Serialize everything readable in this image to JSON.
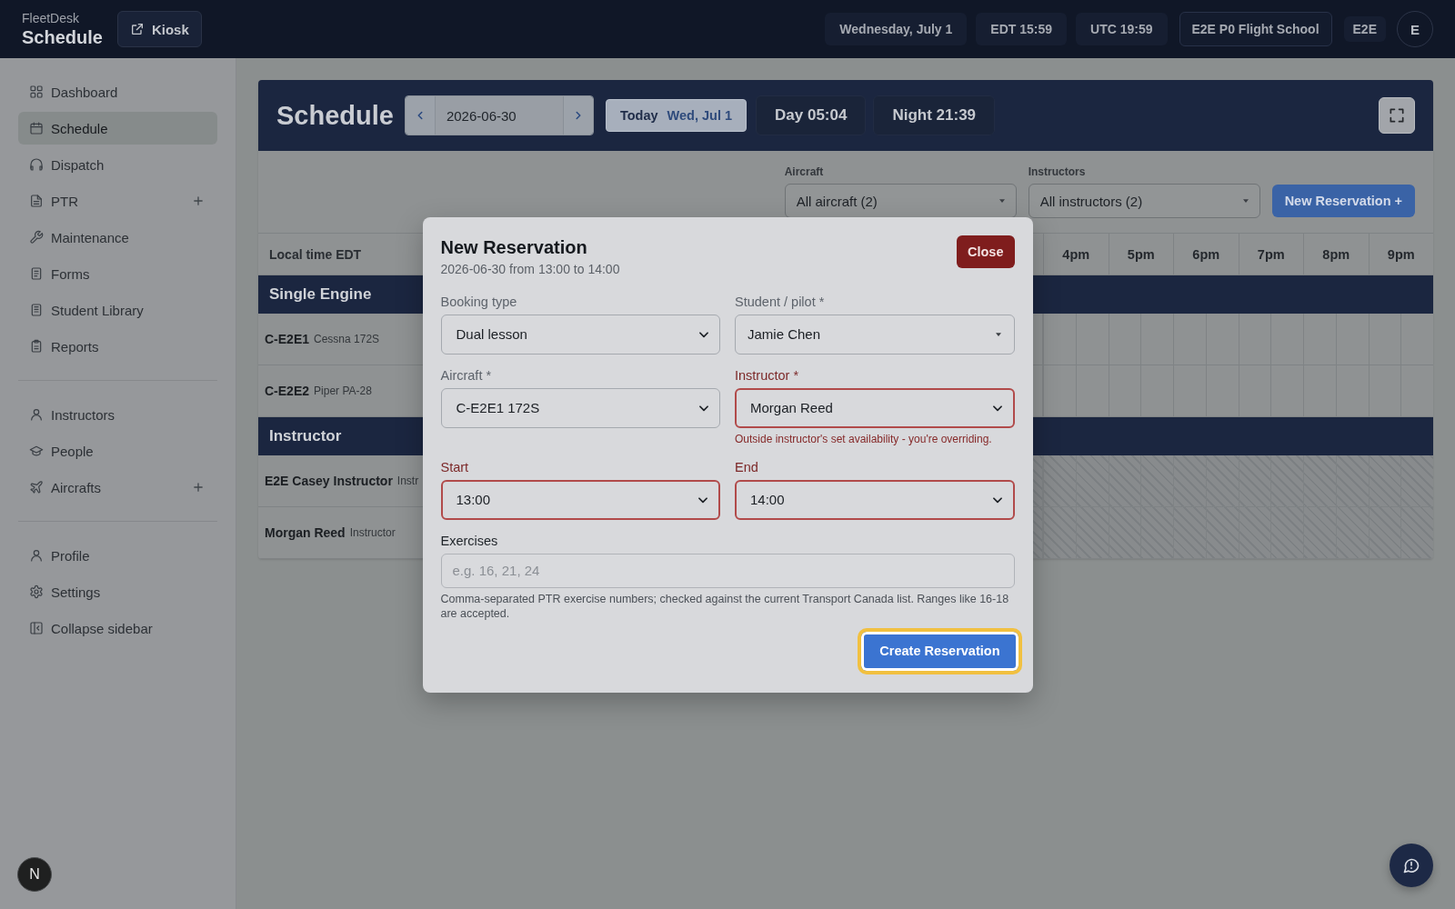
{
  "topbar": {
    "brand": "FleetDesk",
    "page_title": "Schedule",
    "kiosk_button": "Kiosk",
    "chips": [
      {
        "kind": "chip",
        "text": "Wednesday, July 1"
      },
      {
        "kind": "chip",
        "text": "EDT 15:59"
      },
      {
        "kind": "chip",
        "text": "UTC 19:59"
      },
      {
        "kind": "outlined",
        "text": "E2E P0 Flight School"
      },
      {
        "kind": "badge",
        "text": "E2E"
      }
    ],
    "avatar": "E"
  },
  "sidebar": {
    "sections": [
      {
        "items": [
          {
            "label": "Dashboard",
            "selected": false,
            "addable": false
          },
          {
            "label": "Schedule",
            "selected": true,
            "addable": false
          },
          {
            "label": "Dispatch",
            "selected": false,
            "addable": false
          },
          {
            "label": "PTR",
            "selected": false,
            "addable": true
          },
          {
            "label": "Maintenance",
            "selected": false,
            "addable": false
          },
          {
            "label": "Forms",
            "selected": false,
            "addable": false
          },
          {
            "label": "Student Library",
            "selected": false,
            "addable": false
          },
          {
            "label": "Reports",
            "selected": false,
            "addable": false
          }
        ]
      },
      {
        "items": [
          {
            "label": "Instructors",
            "selected": false,
            "addable": false
          },
          {
            "label": "People",
            "selected": false,
            "addable": false
          },
          {
            "label": "Aircrafts",
            "selected": false,
            "addable": true
          }
        ]
      },
      {
        "items": [
          {
            "label": "Profile",
            "selected": false,
            "addable": false
          },
          {
            "label": "Settings",
            "selected": false,
            "addable": false
          },
          {
            "label": "Collapse sidebar",
            "selected": false,
            "addable": false
          }
        ]
      }
    ]
  },
  "schedule": {
    "title": "Schedule",
    "date": "2026-06-30",
    "today_button": {
      "label": "Today",
      "date": "Wed, Jul 1"
    },
    "daylight": [
      "Day 05:04",
      "Night 21:39"
    ],
    "filters": [
      {
        "label": "Aircraft",
        "value": "All aircraft (2)"
      },
      {
        "label": "Instructors",
        "value": "All instructors (2)"
      }
    ],
    "new_button": "New Reservation +",
    "timeline": {
      "corner_label": "Local time EDT",
      "hours": [
        "4pm",
        "5pm",
        "6pm",
        "7pm",
        "8pm",
        "9pm"
      ],
      "groups": [
        {
          "name": "Single Engine",
          "rows": [
            {
              "name": "C-E2E1",
              "detail": "Cessna 172S",
              "unavailable": false
            },
            {
              "name": "C-E2E2",
              "detail": "Piper PA-28",
              "unavailable": false
            }
          ]
        },
        {
          "name": "Instructor",
          "rows": [
            {
              "name": "E2E Casey Instructor",
              "detail": "Instr",
              "unavailable": true
            },
            {
              "name": "Morgan Reed",
              "detail": "Instructor",
              "unavailable": true
            }
          ]
        }
      ]
    }
  },
  "modal": {
    "title": "New Reservation",
    "subtitle": "2026-06-30 from 13:00 to 14:00",
    "close_button": "Close",
    "fields": [
      {
        "kind": "select",
        "label": "Booking type",
        "value": "Dual lesson",
        "invalid": false
      },
      {
        "kind": "combobox",
        "label": "Student / pilot *",
        "value": "Jamie Chen",
        "invalid": false
      },
      {
        "kind": "select",
        "label": "Aircraft *",
        "value": "C-E2E1 172S",
        "invalid": false
      },
      {
        "kind": "select",
        "label": "Instructor *",
        "value": "Morgan Reed",
        "invalid": true,
        "warning": "Outside instructor's set availability - you're overriding."
      },
      {
        "kind": "select",
        "label": "Start",
        "value": "13:00",
        "invalid": true
      },
      {
        "kind": "select",
        "label": "End",
        "value": "14:00",
        "invalid": true
      },
      {
        "kind": "text",
        "label": "Exercises",
        "placeholder": "e.g. 16, 21, 24",
        "help": "Comma-separated PTR exercise numbers; checked against the current Transport Canada list. Ranges like 16-18 are accepted.",
        "invalid": false
      }
    ],
    "submit_button": "Create Reservation",
    "submit_focused": true
  },
  "dev_button": "N"
}
